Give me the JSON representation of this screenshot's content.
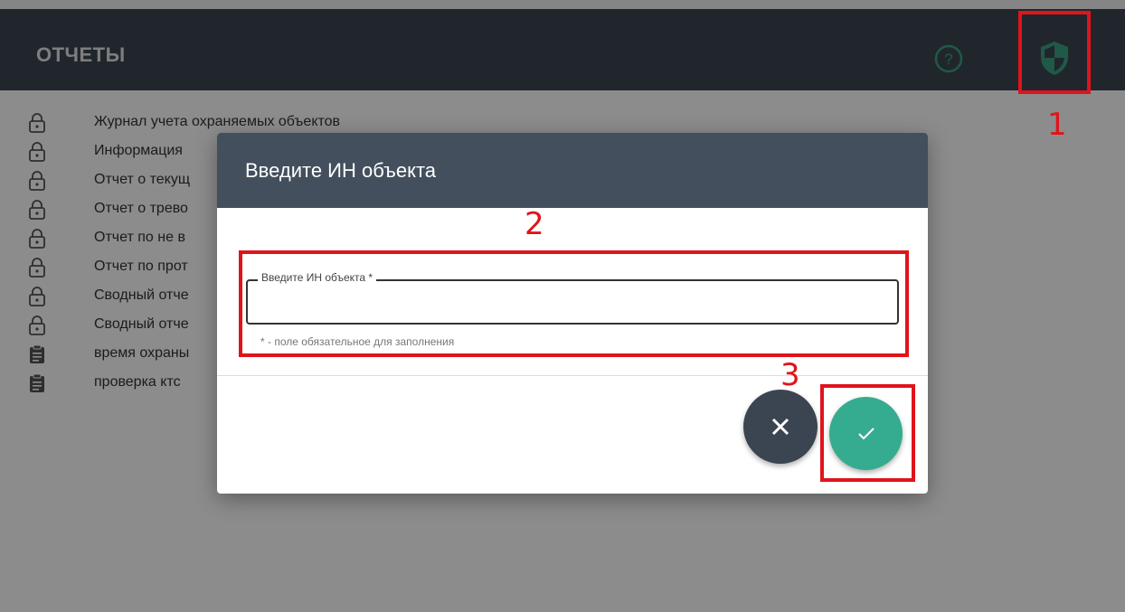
{
  "header": {
    "title": "ОТЧЕТЫ",
    "icons": [
      "help-circle-icon",
      "shield-icon"
    ],
    "bg_color": "#3c4653"
  },
  "reports": {
    "items": [
      {
        "label": "Журнал учета охраняемых объектов",
        "icon": "lock-icon"
      },
      {
        "label": "Информация",
        "icon": "lock-icon"
      },
      {
        "label": "Отчет о текущ",
        "icon": "lock-icon"
      },
      {
        "label": "Отчет о трево",
        "icon": "lock-icon"
      },
      {
        "label": "Отчет по не в",
        "icon": "lock-icon"
      },
      {
        "label": "Отчет по прот",
        "icon": "lock-icon"
      },
      {
        "label": "Сводный отче",
        "icon": "lock-icon"
      },
      {
        "label": "Сводный отче",
        "icon": "lock-icon"
      },
      {
        "label": "время охраны",
        "icon": "clipboard-icon"
      },
      {
        "label": "проверка ктс",
        "icon": "clipboard-icon"
      }
    ]
  },
  "dialog": {
    "title": "Введите ИН объекта",
    "field_label": "Введите ИН объекта *",
    "field_value": "",
    "hint": "* - поле обязательное для заполнения",
    "cancel_icon": "close-icon",
    "confirm_icon": "check-icon",
    "confirm_color": "#35ac8f",
    "cancel_color": "#3b4552"
  },
  "callouts": {
    "one": "1",
    "two": "2",
    "three": "3",
    "color": "#e0141b"
  }
}
